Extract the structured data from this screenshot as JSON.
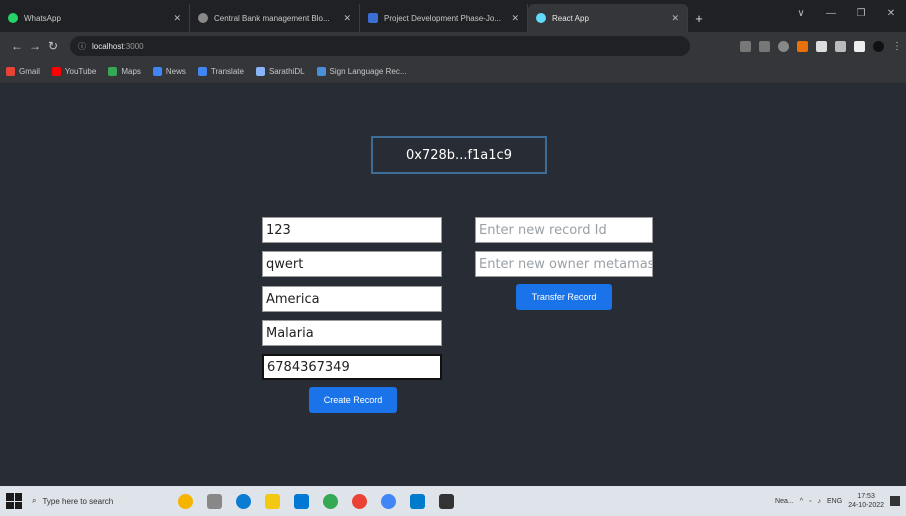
{
  "browser": {
    "tabs": [
      {
        "title": "WhatsApp",
        "color": "#25d366",
        "active": false
      },
      {
        "title": "Central Bank management Blo...",
        "color": "#888888",
        "active": false
      },
      {
        "title": "Project Development Phase-Jo...",
        "color": "#3b6fd4",
        "active": false
      },
      {
        "title": "React App",
        "color": "#61dafb",
        "active": true
      }
    ],
    "new_tab": "+",
    "window_controls": [
      "∨",
      "—",
      "❐",
      "✕"
    ],
    "address": {
      "host": "localhost",
      "port": ":3000"
    },
    "bookmarks": [
      {
        "label": "Gmail",
        "color": "#ea4335"
      },
      {
        "label": "YouTube",
        "color": "#ff0000"
      },
      {
        "label": "Maps",
        "color": "#34a853"
      },
      {
        "label": "News",
        "color": "#4285f4"
      },
      {
        "label": "Translate",
        "color": "#4285f4"
      },
      {
        "label": "SarathiDL",
        "color": "#8ab4f8"
      },
      {
        "label": "Sign Language Rec...",
        "color": "#4a90d9"
      }
    ]
  },
  "app": {
    "account": "0x728b...f1a1c9",
    "create_form": {
      "fields": [
        {
          "value": "123",
          "placeholder": ""
        },
        {
          "value": "qwert",
          "placeholder": ""
        },
        {
          "value": "America",
          "placeholder": ""
        },
        {
          "value": "Malaria",
          "placeholder": ""
        },
        {
          "value": "6784367349",
          "placeholder": ""
        }
      ],
      "button": "Create Record"
    },
    "transfer_form": {
      "record_id_placeholder": "Enter new record Id",
      "owner_placeholder": "Enter new owner metamas",
      "button": "Transfer Record"
    }
  },
  "taskbar": {
    "search_placeholder": "Type here to search",
    "weather": "Nea...",
    "lang": "ENG",
    "time": "17:53",
    "date": "24-10-2022"
  },
  "colors": {
    "accent": "#1a73e8",
    "page_bg": "#282c34",
    "account_border": "#3d6d96"
  }
}
